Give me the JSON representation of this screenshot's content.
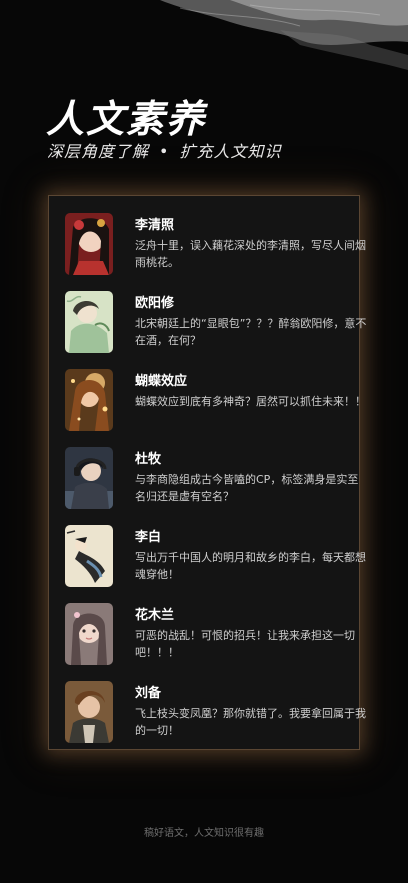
{
  "header": {
    "title": "人文素养",
    "subtitle_left": "深层角度了解",
    "subtitle_sep": "•",
    "subtitle_right": "扩充人文知识"
  },
  "list": [
    {
      "name": "李清照",
      "desc": "泛舟十里，误入藕花深处的李清照，写尽人间烟雨桃花。"
    },
    {
      "name": "欧阳修",
      "desc": "北宋朝廷上的“显眼包”？？？醉翁欧阳修，意不在酒，在何？"
    },
    {
      "name": "蝴蝶效应",
      "desc": "蝴蝶效应到底有多神奇？居然可以抓住未来！！"
    },
    {
      "name": "杜牧",
      "desc": "与李商隐组成古今皆嗑的CP，标签满身是实至名归还是虚有空名？"
    },
    {
      "name": "李白",
      "desc": "写出万千中国人的明月和故乡的李白，每天都想魂穿他！"
    },
    {
      "name": "花木兰",
      "desc": "可恶的战乱！可恨的招兵！让我来承担这一切吧！！！"
    },
    {
      "name": "刘备",
      "desc": "飞上枝头变凤凰？那你就错了。我要拿回属于我的一切！"
    }
  ],
  "footer": {
    "text": "稿好语文，人文知识很有趣"
  },
  "colors": {
    "background": "#070707",
    "panel": "#141414",
    "glow": "#b4824f",
    "text": "#ffffff",
    "muted": "#cfcfcf"
  }
}
